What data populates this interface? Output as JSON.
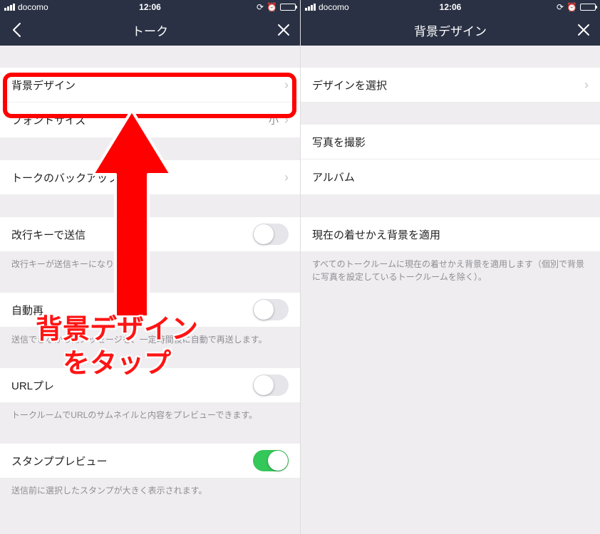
{
  "status": {
    "carrier": "docomo",
    "time": "12:06"
  },
  "left": {
    "title": "トーク",
    "rows": {
      "bg_design": "背景デザイン",
      "font_size": "フォントサイズ",
      "font_size_value": "小",
      "backup": "トークのバックアップ",
      "enter_send": "改行キーで送信",
      "enter_send_note": "改行キーが送信キーになります。",
      "auto_resend": "自動再",
      "auto_resend_note": "送信できなかったメッセージを、一定時間後に自動で再送します。",
      "url_preview": "URLプレ",
      "url_preview_note": "トークルームでURLのサムネイルと内容をプレビューできます。",
      "stamp_preview": "スタンププレビュー",
      "stamp_preview_note": "送信前に選択したスタンプが大きく表示されます。"
    }
  },
  "right": {
    "title": "背景デザイン",
    "rows": {
      "select_design": "デザインを選択",
      "take_photo": "写真を撮影",
      "album": "アルバム",
      "apply_theme": "現在の着せかえ背景を適用",
      "apply_theme_note": "すべてのトークルームに現在の着せかえ背景を適用します（個別で背景に写真を設定しているトークルームを除く）。"
    }
  },
  "annotation": {
    "line1": "背景デザイン",
    "line2": "をタップ"
  }
}
